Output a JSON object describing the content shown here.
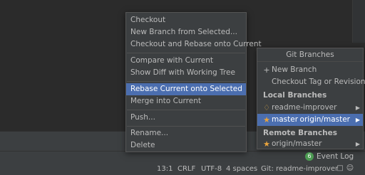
{
  "context_menu": {
    "items": [
      {
        "label": "Checkout"
      },
      {
        "label": "New Branch from Selected..."
      },
      {
        "label": "Checkout and Rebase onto Current"
      },
      {
        "label": "Compare with Current"
      },
      {
        "label": "Show Diff with Working Tree"
      },
      {
        "label": "Rebase Current onto Selected",
        "selected": true
      },
      {
        "label": "Merge into Current"
      },
      {
        "label": "Push..."
      },
      {
        "label": "Rename..."
      },
      {
        "label": "Delete"
      }
    ]
  },
  "git_branches": {
    "title": "Git Branches",
    "new_branch": "New Branch",
    "checkout_tag": "Checkout Tag or Revision...",
    "local_header": "Local Branches",
    "local": [
      {
        "name": "readme-improver",
        "icon": "tag-icon"
      },
      {
        "name": "master",
        "icon": "star-icon",
        "tracking": "origin/master",
        "selected": true
      }
    ],
    "remote_header": "Remote Branches",
    "remote": [
      {
        "name": "origin/master",
        "icon": "star-icon"
      }
    ]
  },
  "event_log": {
    "badge": "6",
    "label": "Event Log"
  },
  "status_bar": {
    "position": "13:1",
    "line_sep": "CRLF",
    "encoding": "UTF-8",
    "indent": "4 spaces",
    "vcs": "Git: readme-improver"
  },
  "colors": {
    "background": "#2b2b2b",
    "panel": "#3c3f41",
    "selection": "#4b6eaf",
    "text": "#bbbbbb",
    "star": "#e8a33d"
  }
}
